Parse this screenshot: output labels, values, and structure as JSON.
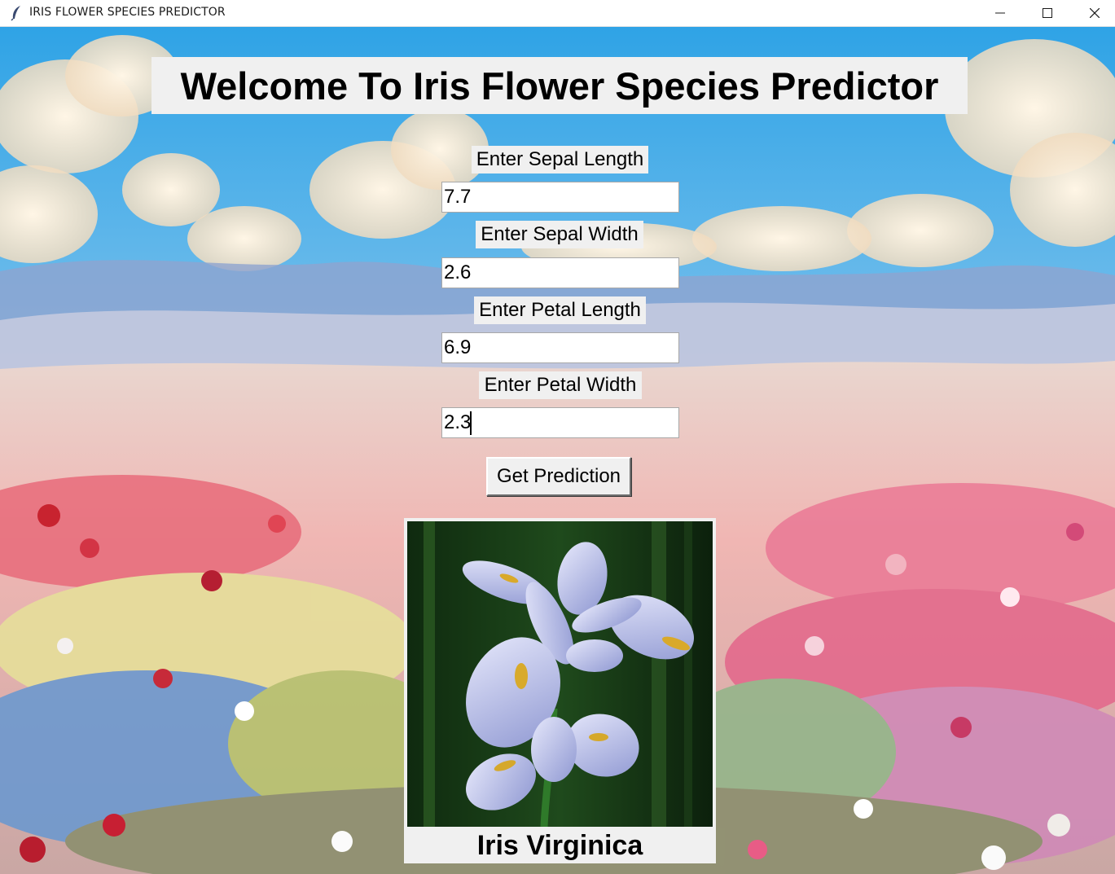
{
  "window": {
    "title": "IRIS FLOWER SPECIES PREDICTOR",
    "icon": "feather-icon",
    "controls": [
      "minimize-icon",
      "maximize-icon",
      "close-icon"
    ]
  },
  "header": {
    "title": "Welcome To Iris Flower Species Predictor"
  },
  "form": {
    "sepal_length": {
      "label": "Enter Sepal Length",
      "value": "7.7"
    },
    "sepal_width": {
      "label": "Enter Sepal Width",
      "value": "2.6"
    },
    "petal_length": {
      "label": "Enter Petal Length",
      "value": "6.9"
    },
    "petal_width": {
      "label": "Enter Petal Width",
      "value": "2.3"
    }
  },
  "actions": {
    "predict_label": "Get Prediction"
  },
  "result": {
    "species": "Iris Virginica",
    "image": "iris-flower-image"
  }
}
